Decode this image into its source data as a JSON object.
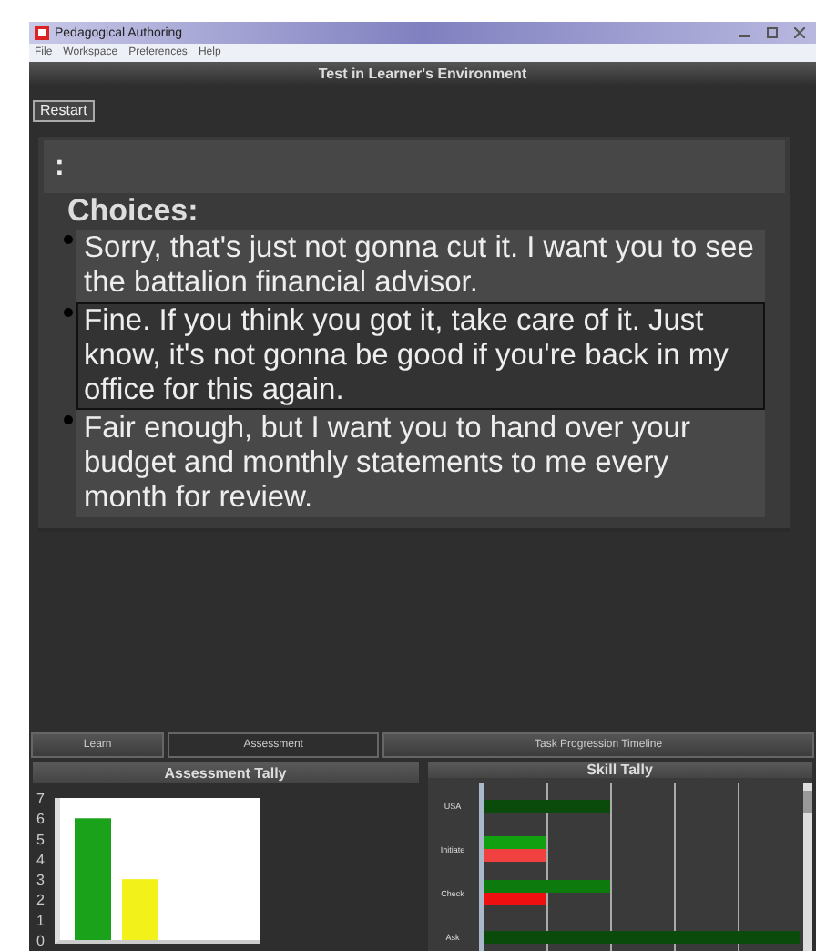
{
  "window": {
    "title": "Pedagogical Authoring"
  },
  "menu": [
    "File",
    "Workspace",
    "Preferences",
    "Help"
  ],
  "header": {
    "title": "Test in Learner's Environment"
  },
  "restart_button": "Restart",
  "prompt": ":",
  "choices_title": "Choices:",
  "choices": [
    {
      "text": "Sorry, that's just not gonna cut it. I want you to see the battalion financial advisor.",
      "selected": false
    },
    {
      "text": "Fine. If you think you got it, take care of it. Just know, it's not gonna be good if you're back in my office for this again.",
      "selected": true
    },
    {
      "text": "Fair enough, but I want you to hand over your budget and monthly statements to me every month for review.",
      "selected": false
    }
  ],
  "tabs": [
    {
      "label": "Learn",
      "selected": false
    },
    {
      "label": "Assessment",
      "selected": true
    },
    {
      "label": "Task Progression Timeline",
      "selected": false
    }
  ],
  "assessment_tally": {
    "title": "Assessment Tally",
    "chart_data": {
      "type": "bar",
      "categories": [
        null,
        null,
        null
      ],
      "values": [
        6,
        3,
        0
      ],
      "ylim": [
        0,
        7
      ],
      "yticks": [
        0,
        1,
        2,
        3,
        4,
        5,
        6,
        7
      ]
    }
  },
  "skill_tally": {
    "title": "Skill Tally",
    "rows": [
      {
        "label": "USA"
      },
      {
        "label": "Initiate"
      },
      {
        "label": "Check"
      },
      {
        "label": "Ask"
      }
    ]
  }
}
